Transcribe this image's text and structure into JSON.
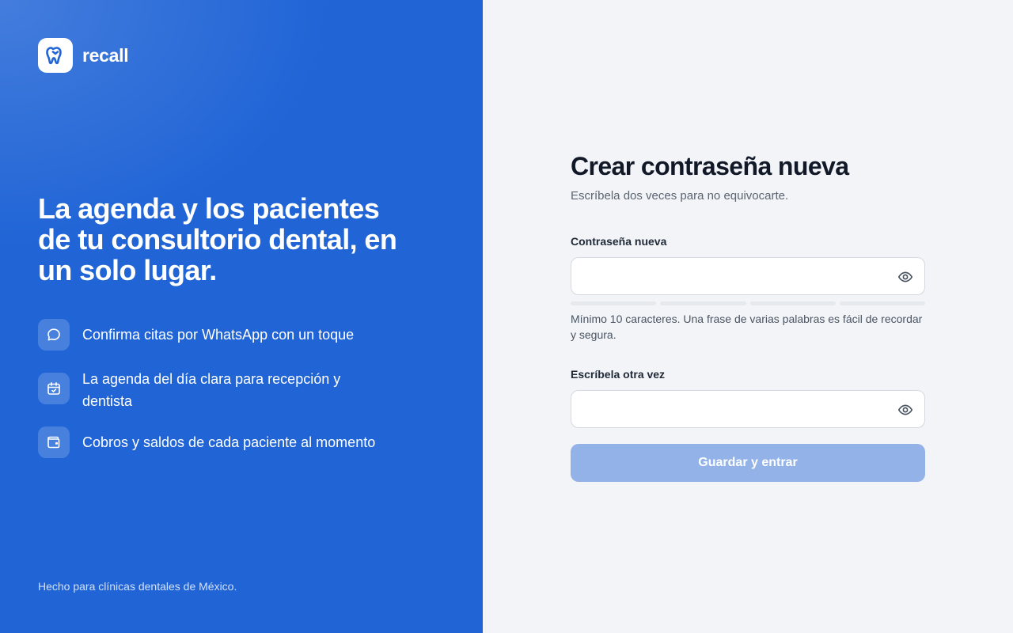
{
  "colors": {
    "brand_blue": "#2064d6",
    "panel_background": "#f2f4f7",
    "button_disabled": "#93b3e8",
    "title_text": "#111827"
  },
  "brand": {
    "logo_icon": "tooth-icon",
    "name": "recall",
    "headline": "La agenda y los pacientes de tu consultorio dental, en un solo lugar.",
    "features": [
      {
        "icon": "chat-bubble-icon",
        "text": "Confirma citas por WhatsApp con un toque"
      },
      {
        "icon": "calendar-check-icon",
        "text": "La agenda del día clara para recepción y dentista"
      },
      {
        "icon": "wallet-icon",
        "text": "Cobros y saldos de cada paciente al momento"
      }
    ],
    "footnote": "Hecho para clínicas dentales de México."
  },
  "form": {
    "title": "Crear contraseña nueva",
    "subtitle": "Escríbela dos veces para no equivocarte.",
    "new_password": {
      "label": "Contraseña nueva",
      "value": "",
      "toggle_icon": "eye-icon"
    },
    "strength_segments": 4,
    "hint": "Mínimo 10 caracteres. Una frase de varias palabras es fácil de recordar y segura.",
    "confirm_password": {
      "label": "Escríbela otra vez",
      "value": "",
      "toggle_icon": "eye-icon"
    },
    "submit_label": "Guardar y entrar",
    "submit_disabled": true
  }
}
